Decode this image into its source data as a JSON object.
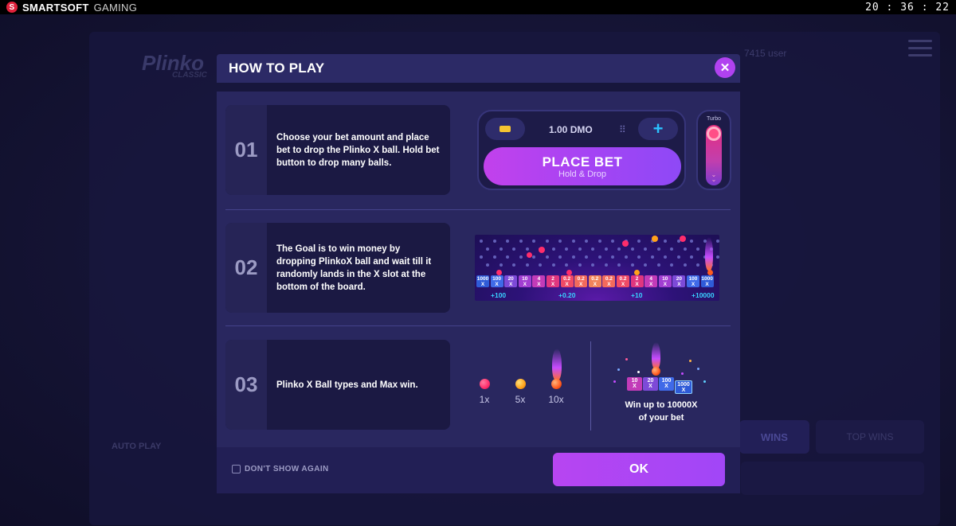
{
  "topbar": {
    "brand_bold": "SMARTSOFT",
    "brand_light": "GAMING",
    "clock": "20 : 36 : 22"
  },
  "background": {
    "logo": "Plinko",
    "logo_sub": "CLASSIC",
    "users": "7415 user",
    "autoplay": "AUTO PLAY",
    "wins_tab": "WINS",
    "top_wins_tab": "TOP WINS"
  },
  "modal": {
    "title": "HOW TO PLAY",
    "close_icon": "close-icon",
    "steps": [
      {
        "number": "01",
        "text": "Choose your bet amount and place bet to drop the Plinko X ball. Hold bet button to drop many balls."
      },
      {
        "number": "02",
        "text": "The Goal is to win money by dropping PlinkoX ball and wait till it randomly lands in the X slot at the bottom of the board."
      },
      {
        "number": "03",
        "text": "Plinko X Ball types and Max win."
      }
    ],
    "bet_panel": {
      "amount": "1.00 DMO",
      "place_bet": "PLACE BET",
      "place_bet_sub": "Hold & Drop",
      "turbo_label": "Turbo"
    },
    "board": {
      "slots": [
        "1000 X",
        "100 X",
        "20 X",
        "10 X",
        "4 X",
        "2 X",
        "0.2 X",
        "0.2 X",
        "0.2 X",
        "0.2 X",
        "0.2 X",
        "2 X",
        "4 X",
        "10 X",
        "20 X",
        "100 X",
        "1000 X"
      ],
      "wins": [
        "+100",
        "+0.20",
        "+10",
        "+10000"
      ]
    },
    "ball_types": [
      {
        "label": "1x",
        "color": "#ff2d6b"
      },
      {
        "label": "5x",
        "color": "#ffa21a"
      },
      {
        "label": "10x",
        "color": "#ff5a1f"
      }
    ],
    "max_win": {
      "slots": [
        "10 X",
        "20 X",
        "100 X",
        "1000 X"
      ],
      "line1": "Win up to 10000X",
      "line2": "of your bet"
    },
    "footer": {
      "dont_show": "DON'T SHOW AGAIN",
      "ok": "OK"
    }
  },
  "colors": {
    "accent": "#b142f0",
    "modal_bg": "#29275f",
    "win_text": "#39d0ff"
  }
}
